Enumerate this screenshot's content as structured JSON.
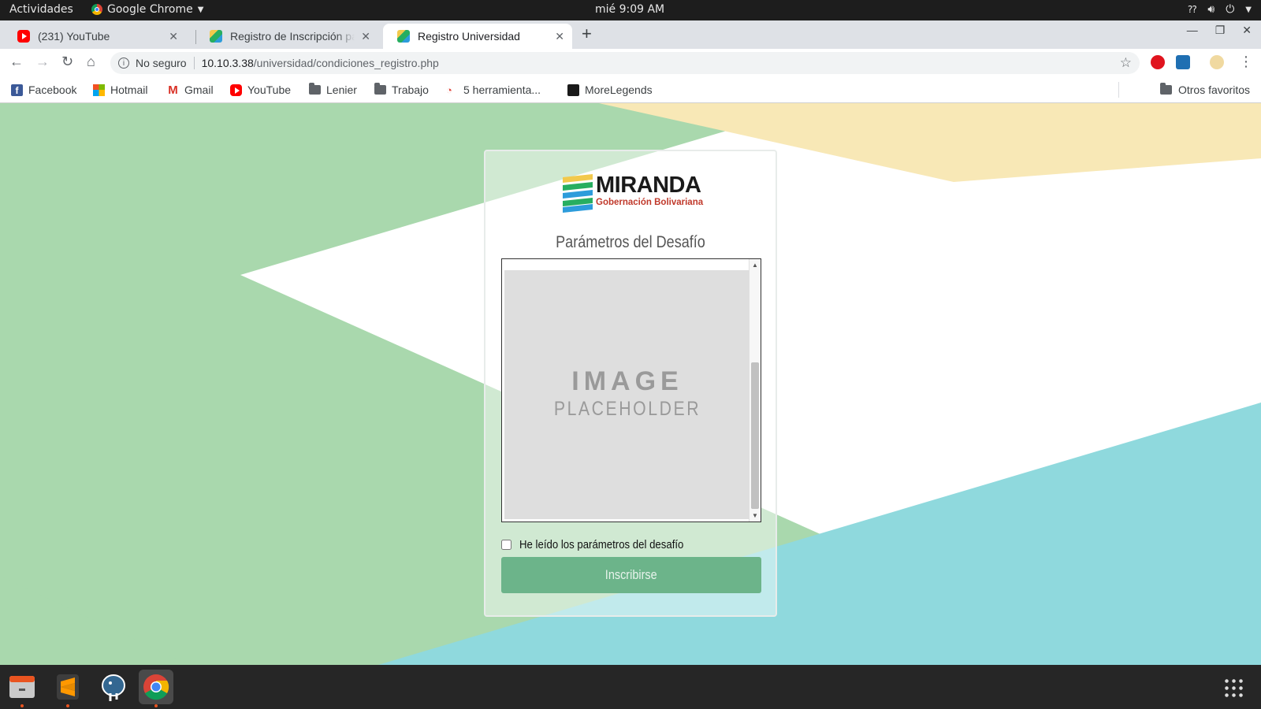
{
  "topbar": {
    "activities": "Actividades",
    "app_name": "Google Chrome",
    "clock": "mié  9:09 AM"
  },
  "tabs": [
    {
      "title": "(231) YouTube",
      "favicon": "youtube-icon"
    },
    {
      "title": "Registro de Inscripción pa",
      "favicon": "miranda-icon"
    },
    {
      "title": "Registro Universidad",
      "favicon": "miranda-icon",
      "active": true
    }
  ],
  "toolbar": {
    "security_label": "No seguro",
    "url_host": "10.10.3.38",
    "url_path": "/universidad/condiciones_registro.php"
  },
  "bookmarks": [
    {
      "label": "Facebook",
      "icon": "facebook-icon"
    },
    {
      "label": "Hotmail",
      "icon": "microsoft-icon"
    },
    {
      "label": "Gmail",
      "icon": "gmail-icon"
    },
    {
      "label": "YouTube",
      "icon": "youtube-icon"
    },
    {
      "label": "Lenier",
      "icon": "folder-icon"
    },
    {
      "label": "Trabajo",
      "icon": "folder-icon"
    },
    {
      "label": "5 herramienta...",
      "icon": "gauge-icon"
    },
    {
      "label": "MoreLegends",
      "icon": "morelegends-icon"
    }
  ],
  "other_bookmarks": "Otros favoritos",
  "card": {
    "logo_word": "MIRANDA",
    "logo_sub": "Gobernación Bolivariana",
    "title": "Parámetros del Desafío",
    "placeholder_main": "IMAGE",
    "placeholder_sub": "PLACEHOLDER",
    "checkbox_label": "He leído los parámetros del desafío",
    "submit_label": "Inscribirse"
  },
  "colors": {
    "bg_green": "#a8d7ad",
    "bg_yellow": "#f8e8b6",
    "bg_teal": "#8fd9dd",
    "button": "#6cb48a"
  }
}
